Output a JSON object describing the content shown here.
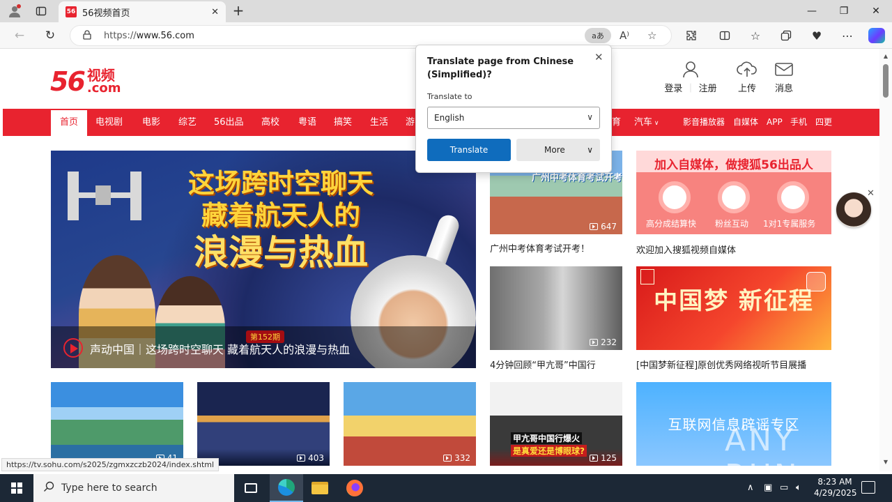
{
  "browser": {
    "tab_title": "56视频首页",
    "tab_favicon": "56",
    "url_proto": "https://",
    "url_domain": "www.56.com",
    "translate_pill": "aあ",
    "status_url": "https://tv.sohu.com/s2025/zgmxzczb2024/index.shtml"
  },
  "site": {
    "logo_num": "56",
    "logo_cn": "视频",
    "logo_com": ".com",
    "header": {
      "login": "登录",
      "register": "注册",
      "upload": "上传",
      "messages": "消息"
    },
    "nav": [
      "首页",
      "电视剧",
      "电影",
      "综艺",
      "56出品",
      "高校",
      "粤语",
      "搞笑",
      "生活",
      "游"
    ],
    "nav_right": {
      "partial": "育",
      "auto": "汽车",
      "player": "影音播放器",
      "wemedia": "自媒体",
      "app": "APP",
      "mobile": "手机",
      "more": "四更"
    }
  },
  "banner": {
    "title_line1": "这场跨时空聊天",
    "title_line2": "藏着航天人的",
    "title_line3": "浪漫与热血",
    "episode_badge": "第152期",
    "caption": "声动中国｜这场跨时空聊天 藏着航天人的浪漫与热血"
  },
  "videos": [
    {
      "title": "广州中考体育考试开考！",
      "count": "647",
      "overlay": "广州中考体育考试开考"
    },
    {
      "title": "4分钟回顾“甲亢哥”中国行",
      "count": "232"
    },
    {
      "title": "",
      "count": "41"
    },
    {
      "title": "",
      "count": "403"
    },
    {
      "title": "",
      "count": "332"
    },
    {
      "title": "",
      "count": "125",
      "overlay1": "甲亢哥中国行爆火",
      "overlay2": "是真爱还是博眼球?"
    }
  ],
  "ads": {
    "ad1_head": "加入自媒体，做搜狐56出品人",
    "ad1_labels": [
      "高分成结算快",
      "粉丝互动",
      "1对1专属服务"
    ],
    "ad1_caption": "欢迎加入搜狐视频自媒体",
    "ad2_text": "中国梦 新征程",
    "ad2_caption": "[中国梦新征程]原创优秀网络视听节目展播",
    "ad3_text": "互联网信息辟谣专区"
  },
  "translate_popup": {
    "title": "Translate page from Chinese (Simplified)?",
    "label": "Translate to",
    "selected_language": "English",
    "translate_button": "Translate",
    "more_button": "More"
  },
  "taskbar": {
    "search_placeholder": "Type here to search",
    "time": "8:23 AM",
    "date": "4/29/2025"
  },
  "watermark": "ANY RUN"
}
